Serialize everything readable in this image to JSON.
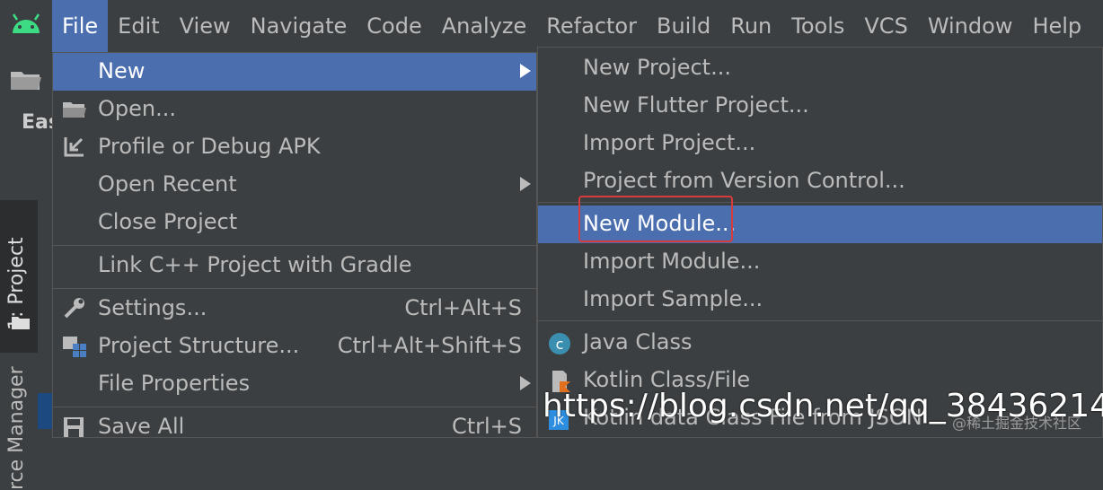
{
  "menubar": {
    "items": [
      "File",
      "Edit",
      "View",
      "Navigate",
      "Code",
      "Analyze",
      "Refactor",
      "Build",
      "Run",
      "Tools",
      "VCS",
      "Window",
      "Help"
    ],
    "active": "File"
  },
  "side": {
    "editor_tab_fragment": "Eas",
    "project_tab": "1: Project",
    "resource_tab": "rce Manager"
  },
  "file_menu": {
    "items": [
      {
        "label": "New",
        "arrow": true,
        "active": true
      },
      {
        "label": "Open...",
        "icon": "open-folder-icon"
      },
      {
        "label": "Profile or Debug APK",
        "icon": "profile-apk-icon"
      },
      {
        "label": "Open Recent",
        "arrow": true
      },
      {
        "label": "Close Project"
      },
      {
        "label": "Link C++ Project with Gradle"
      },
      {
        "label": "Settings...",
        "shortcut": "Ctrl+Alt+S",
        "icon": "wrench-icon"
      },
      {
        "label": "Project Structure...",
        "shortcut": "Ctrl+Alt+Shift+S",
        "icon": "project-structure-icon"
      },
      {
        "label": "File Properties",
        "arrow": true
      },
      {
        "label": "Save All",
        "shortcut": "Ctrl+S",
        "icon": "save-icon"
      }
    ]
  },
  "new_menu": {
    "items": [
      {
        "label": "New Project..."
      },
      {
        "label": "New Flutter Project..."
      },
      {
        "label": "Import Project..."
      },
      {
        "label": "Project from Version Control..."
      },
      {
        "label": "New Module...",
        "active": true
      },
      {
        "label": "Import Module..."
      },
      {
        "label": "Import Sample..."
      },
      {
        "label": "Java Class",
        "icon": "java-class-icon"
      },
      {
        "label": "Kotlin Class/File",
        "icon": "kotlin-file-icon"
      },
      {
        "label": "Kotlin data Class File from JSON",
        "icon": "kotlin-json-icon"
      }
    ]
  },
  "watermark": "https://blog.csdn.net/qq_38436214",
  "watermark_small": "@稀土掘金技术社区",
  "colors": {
    "background": "#3c3f41",
    "selection": "#4b6eaf",
    "highlight_box": "#d83b3b",
    "android_green": "#3ddc84"
  }
}
